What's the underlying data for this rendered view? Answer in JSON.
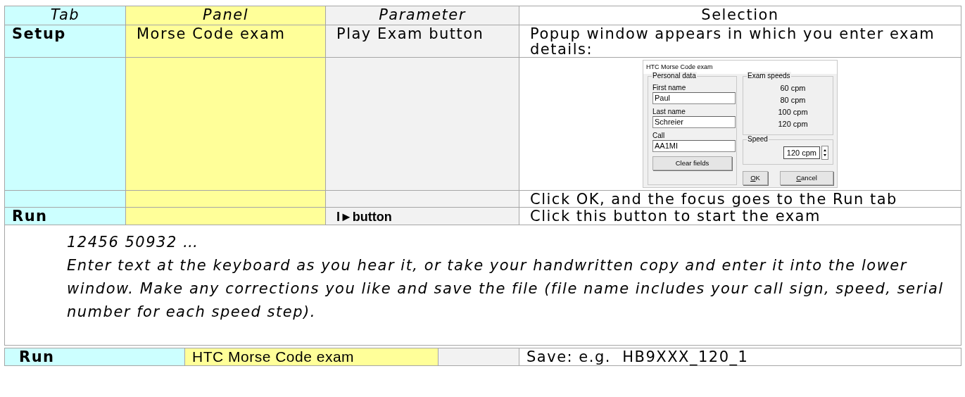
{
  "table": {
    "columns": [
      "Tab",
      "Panel",
      "Parameter",
      "Selection"
    ],
    "rows": [
      {
        "cells": [
          {
            "text": "Setup"
          },
          {
            "text": "Morse Code exam"
          },
          {
            "text": "Play Exam button"
          },
          {
            "text": "Popup window appears in which you enter exam details:"
          }
        ]
      },
      {
        "cells": [
          {},
          {},
          {},
          {
            "kind": "dialog"
          }
        ]
      },
      {
        "cells": [
          {},
          {},
          {},
          {
            "text": "Click OK, and the focus goes to the Run tab"
          }
        ]
      },
      {
        "cells": [
          {
            "text": "Run"
          },
          {},
          {
            "text": "I►button",
            "bold": true
          },
          {
            "text": "Click this button to start the exam"
          }
        ]
      }
    ],
    "note": [
      "12456 50932  …",
      "Enter text at the keyboard as you hear it, or take your handwritten copy and enter it into the lower window. Make any corrections you like and save the file (file name includes your call sign, speed, serial number for each speed step)."
    ]
  },
  "dialog": {
    "title": "HTC Morse Code exam",
    "personal_data": {
      "legend": "Personal data",
      "fields": [
        {
          "label": "First name",
          "value": "Paul"
        },
        {
          "label": "Last name",
          "value": "Schreier"
        },
        {
          "label": "Call",
          "value": "AA1MI"
        }
      ],
      "clear_button": "Clear fields"
    },
    "exam_speeds": {
      "legend": "Exam speeds",
      "items": [
        "60 cpm",
        "80 cpm",
        "100 cpm",
        "120 cpm"
      ]
    },
    "speed": {
      "legend": "Speed",
      "value": "120 cpm"
    },
    "buttons": [
      "OK",
      "Cancel"
    ]
  },
  "bottom_row": {
    "cells": [
      "Run",
      "HTC Morse Code exam",
      "",
      "Save: e.g.  HB9XXX_120_1"
    ]
  }
}
